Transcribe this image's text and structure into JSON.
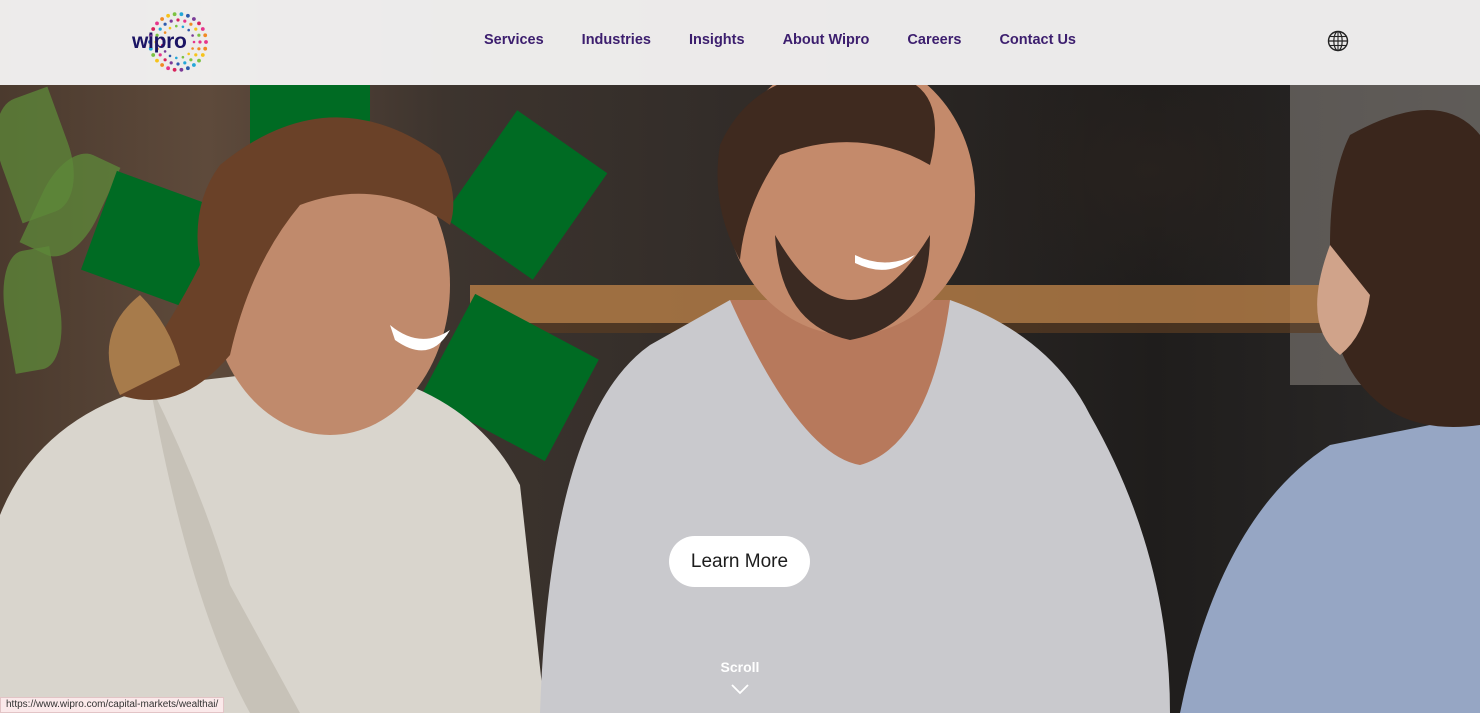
{
  "brand": {
    "logo_text": "wipro"
  },
  "nav": {
    "items": [
      {
        "label": "Services"
      },
      {
        "label": "Industries"
      },
      {
        "label": "Insights"
      },
      {
        "label": "About Wipro"
      },
      {
        "label": "Careers"
      },
      {
        "label": "Contact Us"
      }
    ],
    "language_icon": "globe-icon"
  },
  "hero": {
    "cta_label": "Learn More",
    "scroll_label": "Scroll",
    "scroll_icon": "chevron-down-icon"
  },
  "status_bar": {
    "url": "https://www.wipro.com/capital-markets/wealthai/"
  },
  "colors": {
    "nav_text": "#3c1e6e",
    "logo_text": "#1b1464",
    "accent_green": "#006b23",
    "header_bg": "#f4f2f2",
    "button_bg": "#ffffff"
  }
}
